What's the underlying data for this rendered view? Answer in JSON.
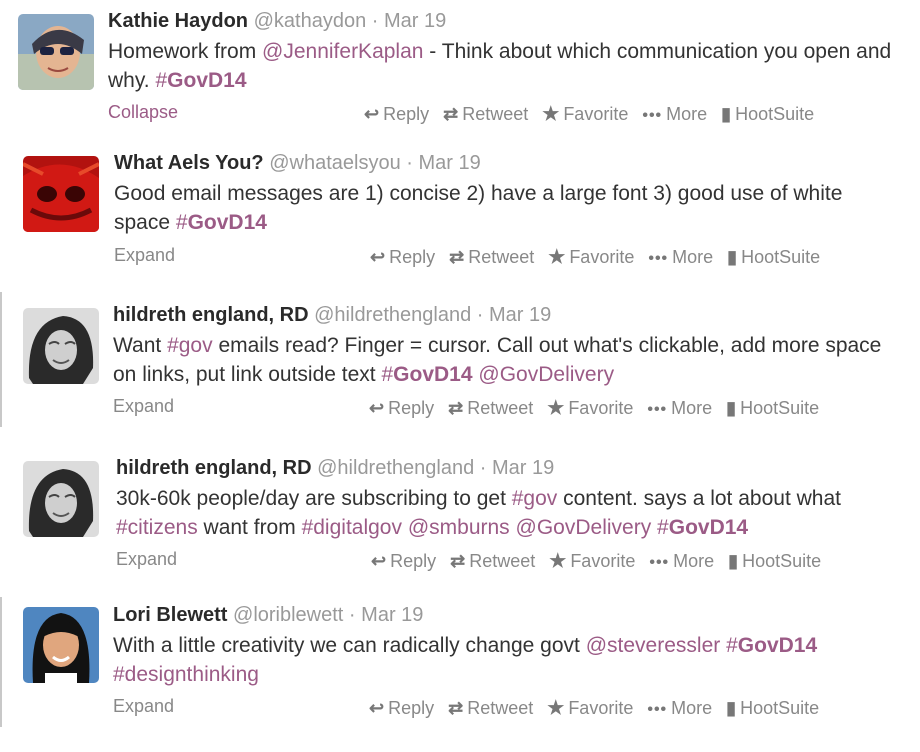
{
  "tweets": [
    {
      "name": "Kathie Haydon",
      "handle": "@kathaydon",
      "sep": "·",
      "date": "Mar 19",
      "parts": [
        {
          "t": "Homework from "
        },
        {
          "t": "@JenniferKaplan",
          "k": "mention"
        },
        {
          "t": " - Think about which communication you open and why.  "
        },
        {
          "t": "#",
          "k": "hash"
        },
        {
          "t": "GovD14",
          "k": "hashbold"
        }
      ],
      "toggle": "Collapse",
      "avatar": "kathie"
    },
    {
      "name": "What Aels You?",
      "handle": "@whataelsyou",
      "sep": "·",
      "date": "Mar 19",
      "parts": [
        {
          "t": "Good email messages are 1) concise 2) have a large font 3) good use of white space "
        },
        {
          "t": "#",
          "k": "hash"
        },
        {
          "t": "GovD14",
          "k": "hashbold"
        }
      ],
      "toggle": "Expand",
      "avatar": "aels"
    },
    {
      "name": "hildreth england, RD",
      "handle": "@hildrethengland",
      "sep": "·",
      "date": "Mar 19",
      "parts": [
        {
          "t": "Want "
        },
        {
          "t": "#gov",
          "k": "hash"
        },
        {
          "t": " emails read? Finger = cursor. Call out what's clickable, add more space on links, put link outside text "
        },
        {
          "t": "#",
          "k": "hash"
        },
        {
          "t": "GovD14",
          "k": "hashbold"
        },
        {
          "t": " "
        },
        {
          "t": "@GovDelivery",
          "k": "mention"
        }
      ],
      "toggle": "Expand",
      "avatar": "hildreth"
    },
    {
      "name": "hildreth england, RD",
      "handle": "@hildrethengland",
      "sep": "·",
      "date": "Mar 19",
      "parts": [
        {
          "t": "30k-60k people/day are subscribing to get "
        },
        {
          "t": "#gov",
          "k": "hash"
        },
        {
          "t": " content. says a lot about what "
        },
        {
          "t": "#citizens",
          "k": "hash"
        },
        {
          "t": " want from "
        },
        {
          "t": "#digitalgov",
          "k": "hash"
        },
        {
          "t": " "
        },
        {
          "t": "@smburns",
          "k": "mention"
        },
        {
          "t": " "
        },
        {
          "t": "@GovDelivery",
          "k": "mention"
        },
        {
          "t": " "
        },
        {
          "t": "#",
          "k": "hash"
        },
        {
          "t": "GovD14",
          "k": "hashbold"
        }
      ],
      "toggle": "Expand",
      "avatar": "hildreth"
    },
    {
      "name": "Lori Blewett",
      "handle": "@loriblewett",
      "sep": "·",
      "date": "Mar 19",
      "parts": [
        {
          "t": "With a little creativity we can radically change govt "
        },
        {
          "t": "@steveressler",
          "k": "mention"
        },
        {
          "t": " "
        },
        {
          "t": "#",
          "k": "hash"
        },
        {
          "t": "GovD14",
          "k": "hashbold"
        },
        {
          "t": " "
        },
        {
          "t": "#designthinking",
          "k": "hash"
        }
      ],
      "toggle": "Expand",
      "avatar": "lori"
    }
  ],
  "actions": {
    "reply": "Reply",
    "retweet": "Retweet",
    "favorite": "Favorite",
    "more": "More",
    "hootsuite": "HootSuite"
  },
  "icons": {
    "reply": "reply-arrow-icon",
    "retweet": "retweet-icon",
    "favorite": "star-icon",
    "more": "more-dots-icon",
    "hootsuite": "hootsuite-owl-icon"
  },
  "colors": {
    "link": "#9b5b86",
    "muted": "#999999",
    "text": "#333333"
  }
}
